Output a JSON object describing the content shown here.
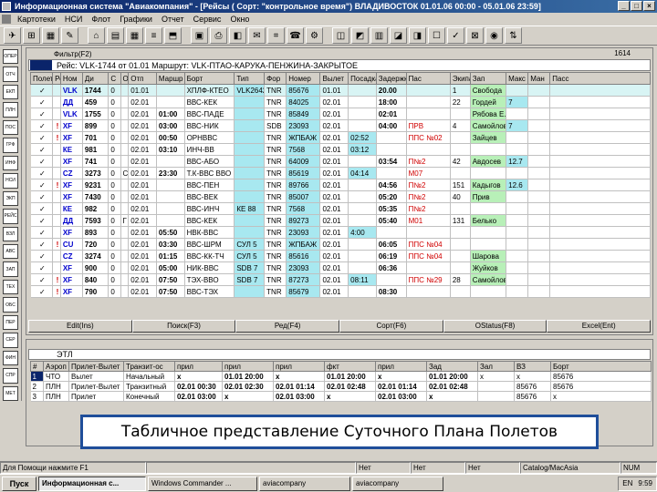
{
  "window": {
    "title": "Информационная система \"Авиакомпания\" - [Рейсы ( Сорт: \"контрольное время\") ВЛАДИВОСТОК 01.01.06 00:00 - 05.01.06 23:59]",
    "controls": [
      "_",
      "□",
      "×"
    ]
  },
  "menu": [
    "Картотеки",
    "НСИ",
    "Флот",
    "Графики",
    "Отчет",
    "Сервис",
    "Окно"
  ],
  "toolbar": {
    "buttons": [
      "✈",
      "⊞",
      "▦",
      "✎",
      "⌂",
      "▤",
      "▦",
      "≡",
      "⬒",
      "▣",
      "⎙",
      "◧",
      "✉",
      "⌗",
      "☎",
      "⚙",
      "◫",
      "◩",
      "▥",
      "◪",
      "◨",
      "☐",
      "✓",
      "⊠",
      "◉",
      "⇅"
    ]
  },
  "leftbar": [
    "ОПЕР",
    "ОТЧ",
    "ЕКП",
    "ПЛН",
    "ПОС",
    "ГРФ",
    "ИНФ",
    "НСИ",
    "ЭКП",
    "РЕЙС",
    "ВЗЛ",
    "АВС",
    "ЗАП",
    "ТЕХ",
    "ОБС",
    "ПЕР",
    "СЕР",
    "ФИН",
    "СПР",
    "МЕТ"
  ],
  "upper": {
    "filter_label": "Фильтр(F2)",
    "counter": "1614",
    "flight_header": "Рейс: VLK-1744 от 01.01  Маршрут: VLK-ПТАО-КАРУКА-ПЕНЖИНА-ЗАКРЫТОЕ",
    "columns": [
      "Полет",
      "Рейс",
      "Ном",
      "Ди",
      "С",
      "Отк",
      "Отп",
      "Маршр",
      "Борт",
      "Тип",
      "Фор",
      "Номер",
      "Вылет",
      "Посадка",
      "Задержка",
      "Пас",
      "Экипаж",
      "Зап",
      "Макс",
      "Ман",
      "Пасс"
    ],
    "rows": [
      [
        "✓",
        "",
        "VLK",
        "1744",
        "0",
        "",
        "01.01",
        "",
        "ХПЛФ-КТЕО",
        "VLK2642",
        "TNR",
        "85676",
        "01.01",
        "",
        "20.00",
        "",
        "1",
        "Свобода",
        "",
        "",
        ""
      ],
      [
        "✓",
        "",
        "ДД",
        "459",
        "0",
        "",
        "02.01",
        "",
        "ВВС-КЕК",
        "",
        "TNR",
        "84025",
        "02.01",
        "",
        "18:00",
        "",
        "22",
        "Гордей",
        "7",
        "",
        ""
      ],
      [
        "✓",
        "",
        "VLK",
        "1755",
        "0",
        "",
        "02.01",
        "01:00",
        "ВВС-ПАДЕ",
        "",
        "TNR",
        "85849",
        "02.01",
        "",
        "02:01",
        "",
        "",
        "Рябова Е.Е",
        "",
        "",
        ""
      ],
      [
        "✓",
        "!",
        "XF",
        "899",
        "0",
        "",
        "02.01",
        "03:00",
        "ВВС-НИК",
        "",
        "SDB",
        "23093",
        "02.01",
        "",
        "04:00",
        "ПРВ",
        "4",
        "Самойлов",
        "7",
        "",
        ""
      ],
      [
        "✓",
        "!",
        "XF",
        "701",
        "0",
        "",
        "02.01",
        "00:50",
        "ОРНВВС",
        "",
        "TNR",
        "ЖПБАЖ",
        "02.01",
        "02:52",
        "",
        "ППС №02",
        "",
        "Зайцев",
        "",
        "",
        ""
      ],
      [
        "✓",
        "",
        "КЕ",
        "981",
        "0",
        "",
        "02.01",
        "03:10",
        "ИНЧ-ВВ",
        "",
        "TNR",
        "7568",
        "02.01",
        "03:12",
        "",
        "",
        "",
        "",
        "",
        "",
        ""
      ],
      [
        "✓",
        "",
        "XF",
        "741",
        "0",
        "",
        "02.01",
        "",
        "ВВС-АБО",
        "",
        "TNR",
        "64009",
        "02.01",
        "",
        "03:54",
        "П№2",
        "42",
        "Авдосев",
        "12.7",
        "",
        ""
      ],
      [
        "✓",
        "",
        "CZ",
        "3273",
        "0",
        "С",
        "02.01",
        "23:30",
        "Т.К-ВВС ВВО",
        "",
        "TNR",
        "85619",
        "02.01",
        "04:14",
        "",
        "М07",
        "",
        "",
        "",
        "",
        ""
      ],
      [
        "✓",
        "!",
        "XF",
        "9231",
        "0",
        "",
        "02.01",
        "",
        "ВВС-ПЕН",
        "",
        "TNR",
        "89766",
        "02.01",
        "",
        "04:56",
        "П№2",
        "151",
        "Кадыгов",
        "12.6",
        "",
        ""
      ],
      [
        "✓",
        "",
        "XF",
        "7430",
        "0",
        "",
        "02.01",
        "",
        "ВВС-ВЕК",
        "",
        "TNR",
        "85007",
        "02.01",
        "",
        "05:20",
        "П№2",
        "40",
        "Прив",
        "",
        "",
        ""
      ],
      [
        "✓",
        "",
        "КЕ",
        "982",
        "0",
        "",
        "02.01",
        "",
        "ВВС-ИНЧ",
        "КЕ 88",
        "TNR",
        "7568",
        "02.01",
        "",
        "05:35",
        "П№2",
        "",
        "",
        "",
        "",
        ""
      ],
      [
        "✓",
        "",
        "ДД",
        "7593",
        "0",
        "Г",
        "02.01",
        "",
        "ВВС-КЕК",
        "",
        "TNR",
        "89273",
        "02.01",
        "",
        "05:40",
        "М01",
        "131",
        "Белько",
        "",
        "",
        ""
      ],
      [
        "✓",
        "",
        "XF",
        "893",
        "0",
        "",
        "02.01",
        "05:50",
        "НВК-ВВС",
        "",
        "TNR",
        "23093",
        "02.01",
        "4:00",
        "",
        "",
        "",
        "",
        "",
        "",
        ""
      ],
      [
        "✓",
        "!",
        "CU",
        "720",
        "0",
        "",
        "02.01",
        "03:30",
        "ВВС-ШРМ",
        "СУЛ 5",
        "TNR",
        "ЖПБАЖ",
        "02.01",
        "",
        "06:05",
        "ППС №04",
        "",
        "",
        "",
        "",
        ""
      ],
      [
        "✓",
        "",
        "CZ",
        "3274",
        "0",
        "",
        "02.01",
        "01:15",
        "ВВС-КК-ТЧ",
        "СУЛ 5",
        "TNR",
        "85616",
        "02.01",
        "",
        "06:19",
        "ППС №04",
        "",
        "Шарова",
        "",
        "",
        ""
      ],
      [
        "✓",
        "",
        "XF",
        "900",
        "0",
        "",
        "02.01",
        "05:00",
        "НИК-ВВС",
        "SDB 7",
        "TNR",
        "23093",
        "02.01",
        "",
        "06:36",
        "",
        "",
        "Жуйков",
        "",
        "",
        ""
      ],
      [
        "✓",
        "!",
        "XF",
        "840",
        "0",
        "",
        "02.01",
        "07:50",
        "ТЭХ-ВВО",
        "SDB 7",
        "TNR",
        "87273",
        "02.01",
        "08:11",
        "",
        "ППС №29",
        "28",
        "Самойлов",
        "",
        "",
        ""
      ],
      [
        "✓",
        "!",
        "XF",
        "790",
        "0",
        "",
        "02.01",
        "07:50",
        "ВВС-ТЭХ",
        "",
        "TNR",
        "85679",
        "02.01",
        "",
        "08:30",
        "",
        "",
        "",
        "",
        "",
        ""
      ]
    ],
    "footer": [
      "Edit(Ins)",
      "Поиск(F3)",
      "Ред(F4)",
      "Сорт(F6)",
      "OStatus(F8)",
      "Excel(Ent)"
    ]
  },
  "lower": {
    "header": "ЭТЛ",
    "columns": [
      "#",
      "Аэроп",
      "Прилет-Вылет",
      "Транзит-ос",
      "прил",
      "прил",
      "прил",
      "фкт",
      "прил",
      "Зад",
      "Зал",
      "ВЗ",
      "Борт"
    ],
    "rows": [
      [
        "1",
        "ЧТО",
        "Вылет",
        "Начальный",
        "х",
        "01.01 20:00",
        "х",
        "01.01 20:00",
        "х",
        "01.01 20:00",
        "х",
        "х",
        "85676"
      ],
      [
        "2",
        "ПЛН",
        "Прилет-Вылет",
        "Транзитный",
        "02.01 00:30",
        "02.01 02:30",
        "02.01 01:14",
        "02.01 02:48",
        "02.01 01:14",
        "02.01 02:48",
        "",
        "85676",
        "85676"
      ],
      [
        "3",
        "ПЛН",
        "Прилет",
        "Конечный",
        "02.01 03:00",
        "х",
        "02.01 03:00",
        "х",
        "02.01 03:00",
        "х",
        "",
        "85676",
        "х"
      ]
    ]
  },
  "caption": "Табличное представление Суточного Плана Полетов",
  "status": [
    "Для Помощи нажмите F1",
    "",
    "Нет",
    "Нет",
    "Нет",
    "Catalog/MacAsia",
    "NUM"
  ],
  "taskbar": {
    "start": "Пуск",
    "tasks": [
      "Информационная с...",
      "Windows Commander ...",
      "aviacompany",
      "aviacompany"
    ],
    "tray": [
      "EN",
      "9:59"
    ]
  },
  "colors": {
    "title_gradient_start": "#0a246a",
    "caption_border": "#1f4e9a",
    "highlight_cyan": "#a8e8f0",
    "highlight_green": "#b8f0b8",
    "alert_red": "#d00000"
  }
}
